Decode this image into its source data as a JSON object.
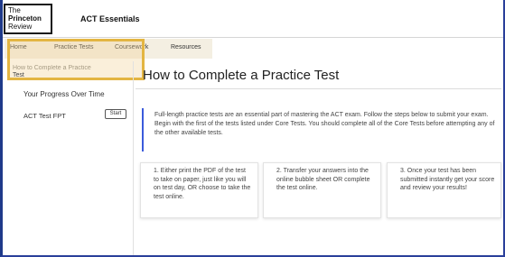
{
  "brand": {
    "logo_line1": "The",
    "logo_line2": "Princeton",
    "logo_line3": "Review",
    "app_title": "ACT Essentials"
  },
  "nav": {
    "items": [
      {
        "label": "Home"
      },
      {
        "label": "Practice Tests"
      },
      {
        "label": "Coursework"
      },
      {
        "label": "Resources"
      }
    ],
    "highlight_color": "#e3b542"
  },
  "sidebar": {
    "item1_line1": "How to Complete a Practice",
    "item1_line2": "Test",
    "item2_label": "Your Progress Over Time",
    "item3_label": "ACT Test FPT",
    "start_label": "Start"
  },
  "main": {
    "title": "How to Complete a Practice Test",
    "intro": "Full-length practice tests are an essential part of mastering the ACT exam. Follow the steps below to submit your exam. Begin with the first of the tests listed under Core Tests. You should complete all of the Core Tests before attempting any of the other available tests.",
    "steps": [
      {
        "text": "1. Either print the PDF of the test to take on paper, just like you will on test day, OR choose to take the test online."
      },
      {
        "text": "2. Transfer your answers into the online bubble sheet OR complete the test online."
      },
      {
        "text": "3. Once your test has been submitted instantly get your score and review your results!"
      }
    ],
    "accent_color": "#3b5bdb"
  }
}
